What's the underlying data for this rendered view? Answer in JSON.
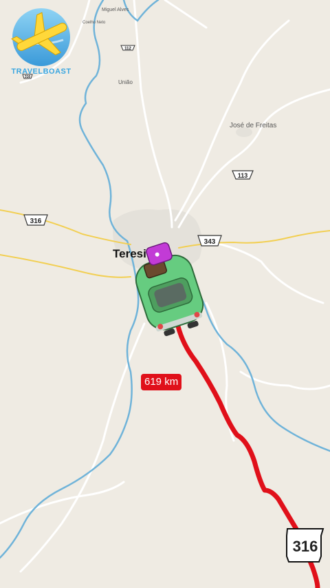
{
  "brand": {
    "name": "TRAVELBOAST"
  },
  "map": {
    "places": [
      {
        "id": "teresina",
        "label": "Teresina",
        "visible_label": "Teresi"
      },
      {
        "id": "jose-de-freitas",
        "label": "José de Freitas"
      },
      {
        "id": "uniao",
        "label": "União"
      },
      {
        "id": "top-small-1",
        "label": "Miguel Alves"
      },
      {
        "id": "top-small-2",
        "label": "Coelho Neto"
      }
    ],
    "route_shields": {
      "r316_left": "316",
      "r343": "343",
      "r113": "113",
      "r112": "112",
      "r316_bottom": "316",
      "r316_small": "316"
    },
    "route": {
      "distance_label": "619 km",
      "color": "#e0101a"
    },
    "colors": {
      "land": "#efebe3",
      "river": "#6fb3d9",
      "highway": "#f2cf52",
      "road": "#ffffff",
      "urban": "#e3e0d8"
    }
  },
  "vehicle": {
    "type": "green-car-with-luggage-icon",
    "color": "#6fd68a"
  }
}
